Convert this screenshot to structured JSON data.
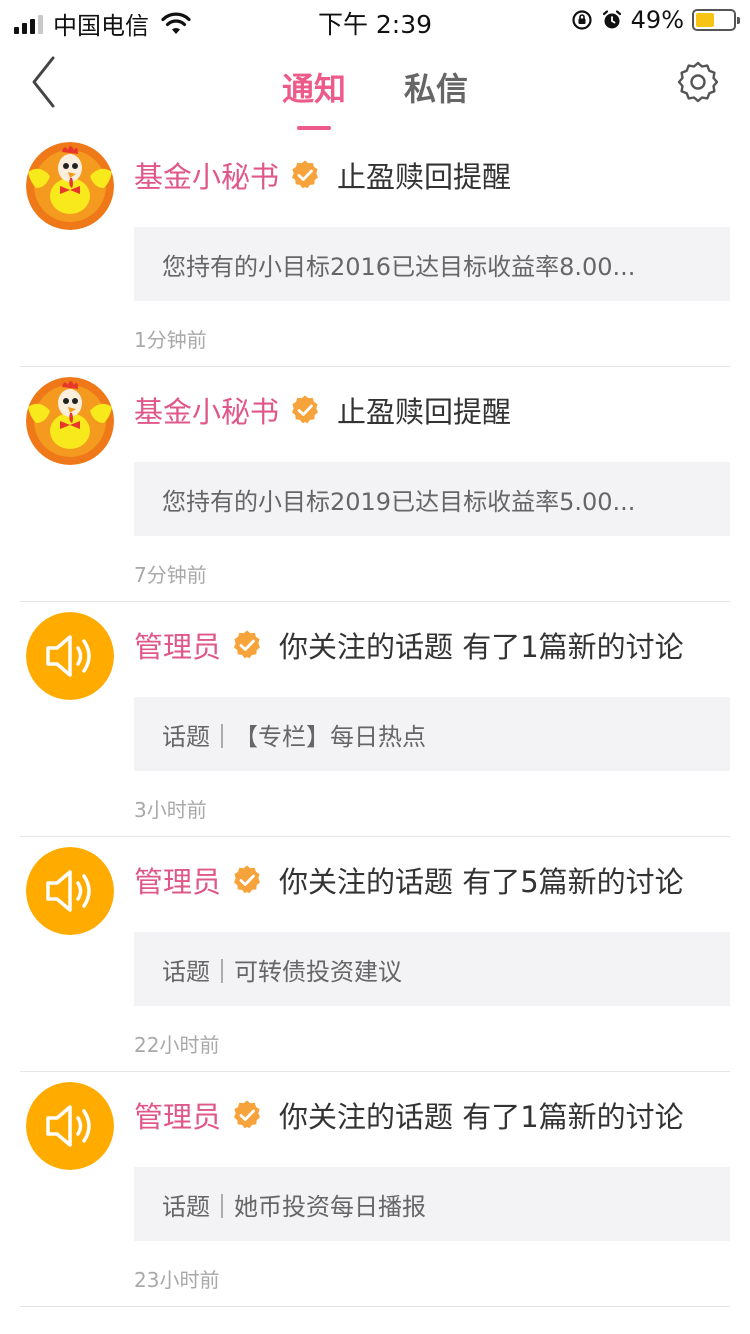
{
  "status_bar": {
    "carrier": "中国电信",
    "time": "下午 2:39",
    "battery_percent": "49%",
    "battery_level": 0.49,
    "battery_color": "#f7c414"
  },
  "nav": {
    "tabs": [
      {
        "label": "通知",
        "active": true
      },
      {
        "label": "私信",
        "active": false
      }
    ],
    "accent_color": "#ec5b8a",
    "back_icon": "chevron-left-icon",
    "settings_icon": "gear-icon"
  },
  "notifications": [
    {
      "avatar": "rooster-mascot",
      "sender": "基金小秘书",
      "title": "止盈赎回提醒",
      "preview": "您持有的小目标2016已达目标收益率8.00...",
      "time": "1分钟前"
    },
    {
      "avatar": "rooster-mascot",
      "sender": "基金小秘书",
      "title": "止盈赎回提醒",
      "preview": "您持有的小目标2019已达目标收益率5.00...",
      "time": "7分钟前"
    },
    {
      "avatar": "speaker-icon",
      "sender": "管理员",
      "title": "你关注的话题 有了1篇新的讨论",
      "preview": "话题｜【专栏】每日热点",
      "time": "3小时前"
    },
    {
      "avatar": "speaker-icon",
      "sender": "管理员",
      "title": "你关注的话题 有了5篇新的讨论",
      "preview": "话题｜可转债投资建议",
      "time": "22小时前"
    },
    {
      "avatar": "speaker-icon",
      "sender": "管理员",
      "title": "你关注的话题 有了1篇新的讨论",
      "preview": "话题｜她币投资每日播报",
      "time": "23小时前"
    }
  ]
}
